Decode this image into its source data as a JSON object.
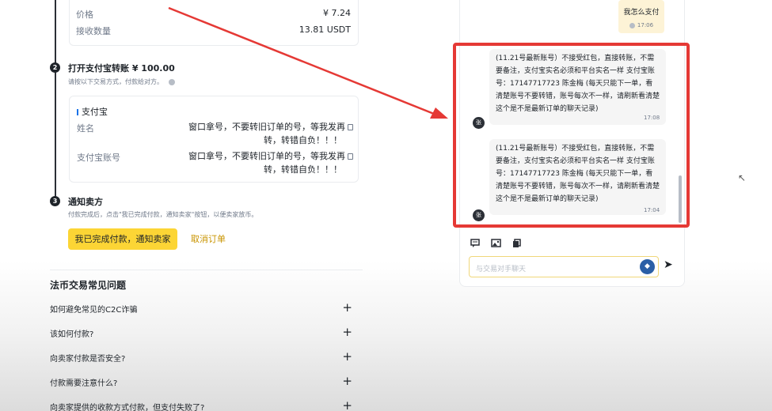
{
  "order": {
    "price_label": "价格",
    "price_value": "¥ 7.24",
    "qty_label": "接收数量",
    "qty_value": "13.81 USDT"
  },
  "step2": {
    "number": "2",
    "title": "打开支付宝转账 ¥ 100.00",
    "subtitle": "请按以下交易方式，付款给对方。",
    "info_icon": "info-icon",
    "method_name": "支付宝",
    "name_label": "姓名",
    "name_value_line1": "窗口拿号，不要转旧订单的号，等我发再",
    "name_value_line2": "转，转错自负！！！",
    "account_label": "支付宝账号",
    "account_value_line1": "窗口拿号，不要转旧订单的号，等我发再",
    "account_value_line2": "转，转错自负！！！",
    "copy_icon": "copy-icon"
  },
  "step3": {
    "number": "3",
    "title": "通知卖方",
    "subtitle": "付款完成后，点击\"我已完成付款，通知卖家\"按钮，以便卖家放币。",
    "confirm_button": "我已完成付款，通知卖家",
    "cancel_link": "取消订单"
  },
  "faq": {
    "title": "法币交易常见问题",
    "items": [
      {
        "q": "如何避免常见的C2C诈骗"
      },
      {
        "q": "该如何付款?"
      },
      {
        "q": "向卖家付款是否安全?"
      },
      {
        "q": "付款需要注意什么?"
      },
      {
        "q": "向卖家提供的收款方式付款，但支付失败了?"
      }
    ],
    "expand_icon": "+"
  },
  "chat": {
    "self_msg": "我怎么支付",
    "self_time": "17:06",
    "messages": [
      {
        "avatar": "张",
        "text": "(11.21号最新账号）不接受红包，直接转账，不需要备注，支付宝实名必须和平台实名一样  支付宝账号：17147717723 陈金梅  (每天只能下一单，看清楚账号不要转错，账号每次不一样，请刷新看清楚这个是不是最新订单的聊天记录)",
        "time": "17:08"
      },
      {
        "avatar": "张",
        "text": "(11.21号最新账号）不接受红包，直接转账，不需要备注，支付宝实名必须和平台实名一样  支付宝账号：17147717723 陈金梅  (每天只能下一单，看清楚账号不要转错，账号每次不一样，请刷新看清楚这个是不是最新订单的聊天记录)",
        "time": "17:04"
      }
    ],
    "input_placeholder": "与交易对手聊天",
    "tools": [
      "message-icon",
      "image-icon",
      "file-icon"
    ]
  },
  "colors": {
    "accent_yellow": "#fcd535",
    "highlight_red": "#e53935",
    "link_gold": "#c99400"
  }
}
